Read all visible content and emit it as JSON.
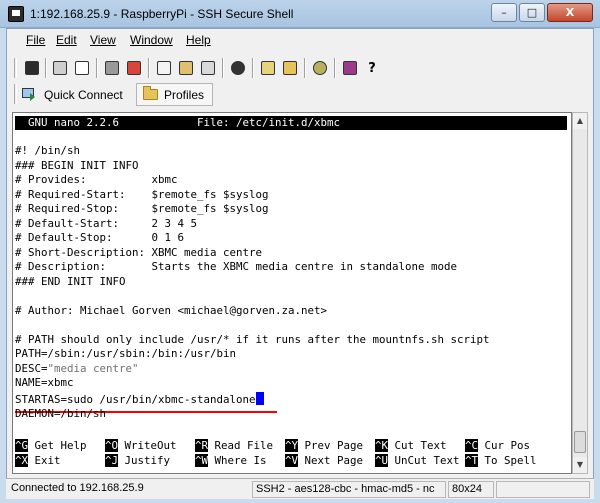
{
  "window": {
    "title": "1:192.168.25.9 - RaspberryPi - SSH Secure Shell",
    "minimize": "–",
    "maximize": "□",
    "close": "X"
  },
  "menu": [
    "File",
    "Edit",
    "View",
    "Window",
    "Help"
  ],
  "toolbar_icons": [
    "save-icon",
    "print-icon",
    "print-preview-icon",
    "disconnect-icon",
    "connect-icon",
    "copy-icon",
    "paste-icon",
    "paste-special-icon",
    "find-icon",
    "file-transfer-icon",
    "sftp-icon",
    "settings-icon",
    "profile-icon",
    "help-icon"
  ],
  "quickbar": {
    "quick_connect": "Quick Connect",
    "profiles": "Profiles"
  },
  "nano": {
    "header": "  GNU nano 2.2.6            File: /etc/init.d/xbmc",
    "lines": [
      "",
      "#! /bin/sh",
      "### BEGIN INIT INFO",
      "# Provides:          xbmc",
      "# Required-Start:    $remote_fs $syslog",
      "# Required-Stop:     $remote_fs $syslog",
      "# Default-Start:     2 3 4 5",
      "# Default-Stop:      0 1 6",
      "# Short-Description: XBMC media centre",
      "# Description:       Starts the XBMC media centre in standalone mode",
      "### END INIT INFO",
      "",
      "# Author: Michael Gorven <michael@gorven.za.net>",
      "",
      "# PATH should only include /usr/* if it runs after the mountnfs.sh script",
      "PATH=/sbin:/usr/sbin:/bin:/usr/bin",
      "",
      "",
      "NAME=xbmc"
    ],
    "desc_key": "DESC=",
    "desc_value": "\"media centre\"",
    "startas": "STARTAS=sudo /usr/bin/xbmc-standalone",
    "daemon": "DAEMON=/bin/sh",
    "shortcuts_row1": [
      {
        "key": "^G",
        "label": " Get Help"
      },
      {
        "key": "^O",
        "label": " WriteOut"
      },
      {
        "key": "^R",
        "label": " Read File"
      },
      {
        "key": "^Y",
        "label": " Prev Page"
      },
      {
        "key": "^K",
        "label": " Cut Text"
      },
      {
        "key": "^C",
        "label": " Cur Pos"
      }
    ],
    "shortcuts_row2": [
      {
        "key": "^X",
        "label": " Exit"
      },
      {
        "key": "^J",
        "label": " Justify"
      },
      {
        "key": "^W",
        "label": " Where Is"
      },
      {
        "key": "^V",
        "label": " Next Page"
      },
      {
        "key": "^U",
        "label": " UnCut Text"
      },
      {
        "key": "^T",
        "label": " To Spell"
      }
    ]
  },
  "status": {
    "connection": "Connected to 192.168.25.9",
    "cipher": "SSH2 - aes128-cbc - hmac-md5 - nc",
    "size": "80x24"
  },
  "colors": {
    "title_bar": "#bcd3ea",
    "underline": "#ff0000",
    "cursor": "#0000ff",
    "comment": "#707070"
  }
}
